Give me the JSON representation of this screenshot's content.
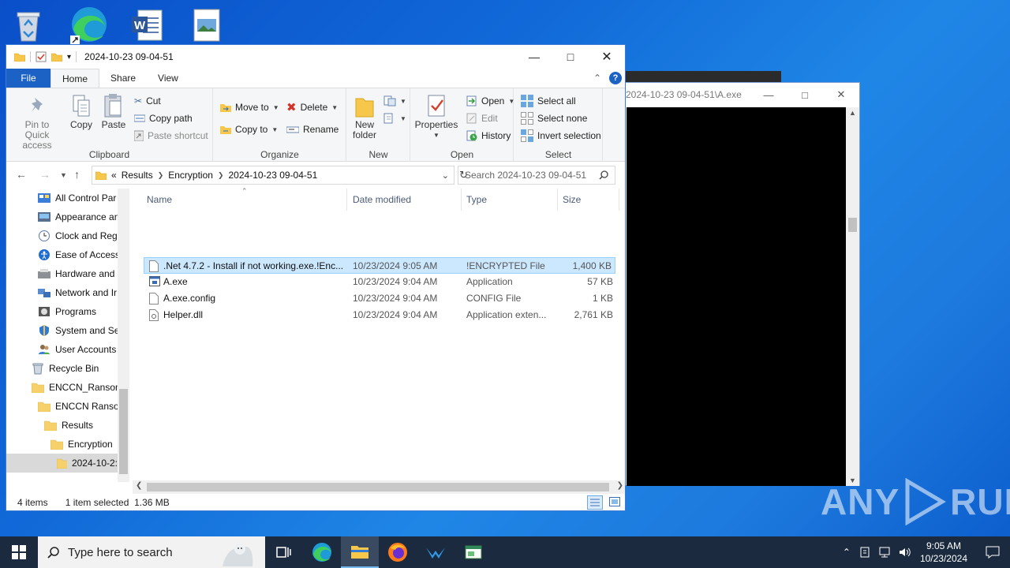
{
  "desktop": {
    "icons": [
      "recycle-bin-icon",
      "edge-icon",
      "word-icon",
      "image-file-icon"
    ]
  },
  "console": {
    "title": "2024-10-23 09-04-51\\A.exe"
  },
  "explorer": {
    "title": "2024-10-23 09-04-51",
    "tabs": [
      "File",
      "Home",
      "Share",
      "View"
    ],
    "active_tab": "Home",
    "ribbon": {
      "clipboard": {
        "label": "Clipboard",
        "pin": "Pin to Quick access",
        "copy": "Copy",
        "paste": "Paste",
        "cut": "Cut",
        "copy_path": "Copy path",
        "paste_shortcut": "Paste shortcut"
      },
      "organize": {
        "label": "Organize",
        "move_to": "Move to",
        "copy_to": "Copy to",
        "delete": "Delete",
        "rename": "Rename"
      },
      "new": {
        "label": "New",
        "new_folder": "New folder"
      },
      "open": {
        "label": "Open",
        "properties": "Properties",
        "open": "Open",
        "edit": "Edit",
        "history": "History"
      },
      "select": {
        "label": "Select",
        "select_all": "Select all",
        "select_none": "Select none",
        "invert": "Invert selection"
      }
    },
    "address": {
      "overflow": "«",
      "crumbs": [
        "Results",
        "Encryption",
        "2024-10-23 09-04-51"
      ],
      "search_placeholder": "Search 2024-10-23 09-04-51"
    },
    "nav": [
      {
        "label": "All Control Par",
        "icon": "control-panel-icon"
      },
      {
        "label": "Appearance an",
        "icon": "appearance-icon"
      },
      {
        "label": "Clock and Regi",
        "icon": "clock-icon"
      },
      {
        "label": "Ease of Access",
        "icon": "ease-of-access-icon"
      },
      {
        "label": "Hardware and",
        "icon": "hardware-icon"
      },
      {
        "label": "Network and Ir",
        "icon": "network-icon"
      },
      {
        "label": "Programs",
        "icon": "programs-icon"
      },
      {
        "label": "System and Sec",
        "icon": "system-security-icon"
      },
      {
        "label": "User Accounts",
        "icon": "user-accounts-icon"
      },
      {
        "label": "Recycle Bin",
        "icon": "recycle-bin-icon"
      },
      {
        "label": "ENCCN_Ransom",
        "icon": "folder-icon"
      },
      {
        "label": "ENCCN Ransor",
        "icon": "folder-icon"
      },
      {
        "label": "Results",
        "icon": "folder-icon"
      },
      {
        "label": "Encryption",
        "icon": "folder-icon"
      },
      {
        "label": "2024-10-2:",
        "icon": "folder-icon"
      }
    ],
    "columns": [
      "Name",
      "Date modified",
      "Type",
      "Size"
    ],
    "files": [
      {
        "name": ".Net 4.7.2 - Install if not working.exe.!Enc...",
        "date": "10/23/2024 9:05 AM",
        "type": "!ENCRYPTED File",
        "size": "1,400 KB",
        "selected": true,
        "icon": "blank-file-icon"
      },
      {
        "name": "A.exe",
        "date": "10/23/2024 9:04 AM",
        "type": "Application",
        "size": "57 KB",
        "selected": false,
        "icon": "application-icon"
      },
      {
        "name": "A.exe.config",
        "date": "10/23/2024 9:04 AM",
        "type": "CONFIG File",
        "size": "1 KB",
        "selected": false,
        "icon": "blank-file-icon"
      },
      {
        "name": "Helper.dll",
        "date": "10/23/2024 9:04 AM",
        "type": "Application exten...",
        "size": "2,761 KB",
        "selected": false,
        "icon": "dll-file-icon"
      }
    ],
    "status": {
      "count": "4 items",
      "selection": "1 item selected  1.36 MB"
    }
  },
  "watermark": {
    "left": "ANY",
    "right": "RUN"
  },
  "taskbar": {
    "search_placeholder": "Type here to search",
    "apps": [
      "task-view-icon",
      "edge-icon",
      "file-explorer-icon",
      "firefox-icon",
      "anyrun-icon",
      "app-window-icon"
    ],
    "time": "9:05 AM",
    "date": "10/23/2024"
  },
  "colors": {
    "accent": "#1c62c4",
    "selection": "#cce8ff",
    "taskbar": "#1b2a3f"
  }
}
